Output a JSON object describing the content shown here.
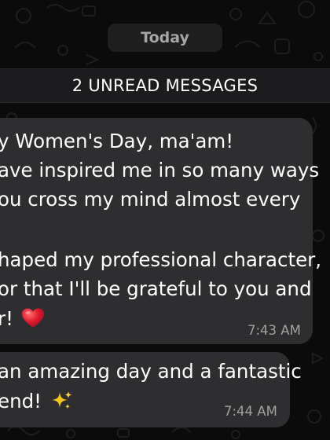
{
  "chat": {
    "date_separator": "Today",
    "unread_banner": "2 UNREAD MESSAGES",
    "messages": [
      {
        "lines": [
          "y Women's Day, ma'am!",
          "ave inspired me in so many ways",
          "ou cross my mind almost every",
          "haped my professional character,",
          "or that I'll be grateful to you and",
          "r!"
        ],
        "emoji": "red-heart",
        "time": "7:43 AM"
      },
      {
        "lines": [
          "an amazing day and a fantastic",
          "end!"
        ],
        "emoji": "sparkles",
        "time": "7:44 AM"
      }
    ]
  },
  "colors": {
    "background": "#0b0b0b",
    "bubble": "#2e2e30",
    "banner": "#1c1c1e",
    "timestamp": "#a0a0a0",
    "heart": "#e0182d",
    "sparkles": "#f5c518"
  },
  "icons": [
    "doodle-wallpaper-pattern",
    "red-heart-emoji",
    "sparkles-emoji"
  ]
}
